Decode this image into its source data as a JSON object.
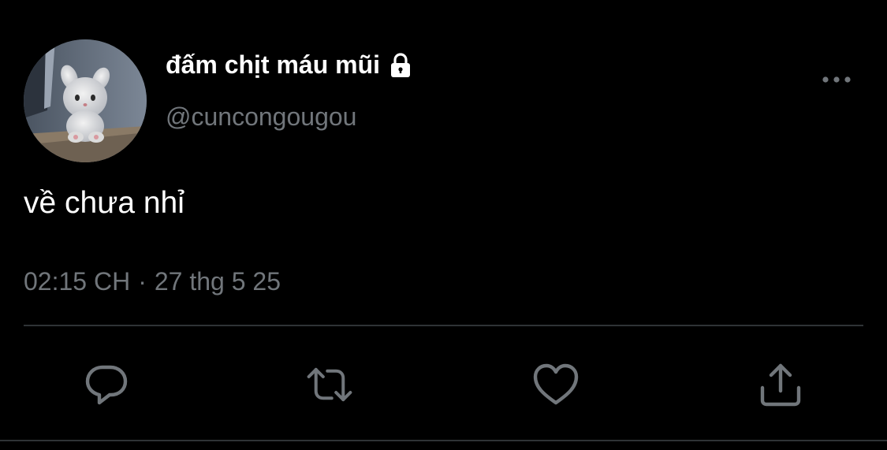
{
  "tweet": {
    "display_name": "đấm chịt máu mũi",
    "handle": "@cuncongougou",
    "text": "về chưa nhỉ",
    "time": "02:15 CH",
    "separator": "·",
    "date": "27 thg 5 25",
    "protected_icon": "lock-icon",
    "avatar": "plush-bunny-avatar"
  },
  "actions": [
    {
      "name": "reply",
      "icon": "reply-icon"
    },
    {
      "name": "retweet",
      "icon": "retweet-icon"
    },
    {
      "name": "like",
      "icon": "heart-icon"
    },
    {
      "name": "share",
      "icon": "share-icon"
    }
  ],
  "more_icon": "more-dots-icon",
  "colors": {
    "background": "#000000",
    "primary_text": "#ffffff",
    "secondary_text": "#71767b",
    "divider": "#2f3336"
  }
}
